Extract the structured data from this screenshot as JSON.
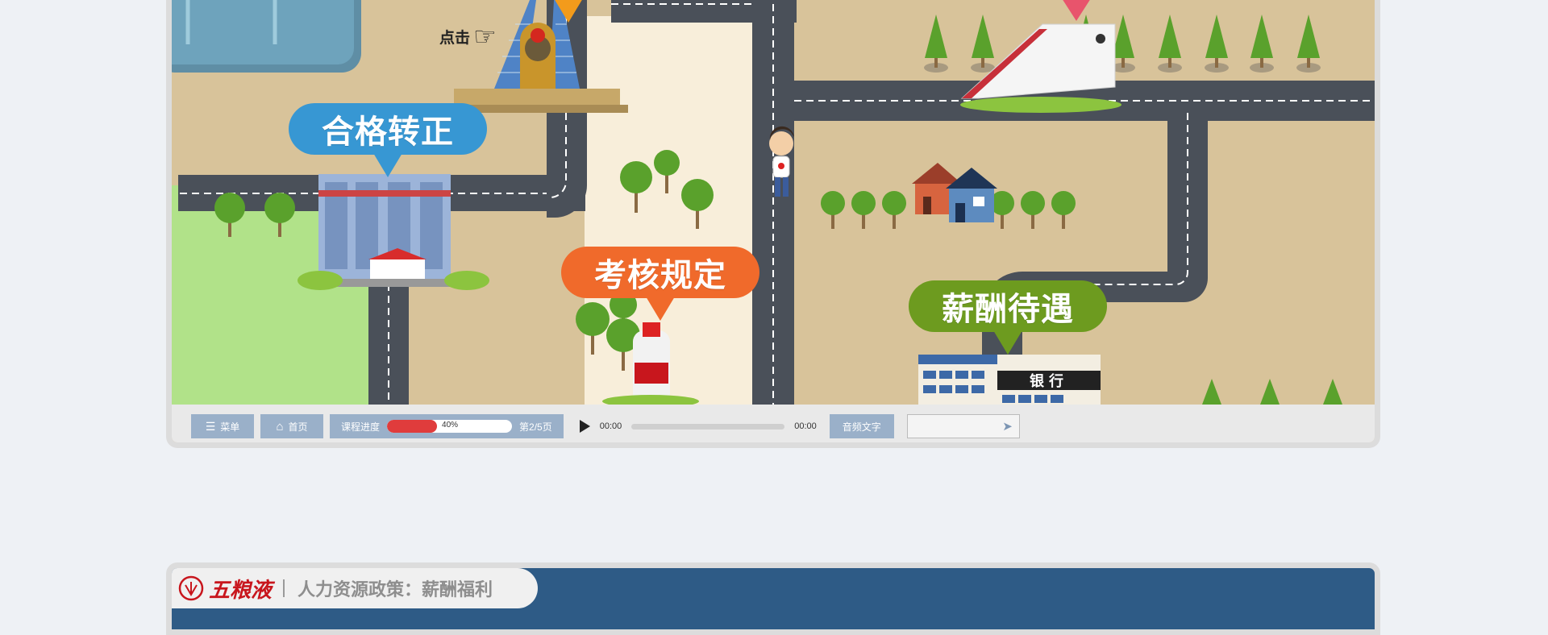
{
  "scene": {
    "click_hint": "点击",
    "callouts": [
      {
        "label": "合格转正",
        "color": "#3797d3"
      },
      {
        "label": "考核规定",
        "color": "#f06a2b"
      },
      {
        "label": "薪酬待遇",
        "color": "#6d9b1f"
      }
    ],
    "bank_sign": "银行"
  },
  "toolbar": {
    "menu_label": "菜单",
    "home_label": "首页",
    "progress_label": "课程进度",
    "progress_percent": 40,
    "progress_text": "40%",
    "page_text": "第2/5页",
    "time_current": "00:00",
    "time_total": "00:00",
    "audio_text_label": "音频文字"
  },
  "next_slide": {
    "brand": "五粮液",
    "course_title": "人力资源政策：薪酬福利",
    "accent_color": "#2e5b86"
  }
}
